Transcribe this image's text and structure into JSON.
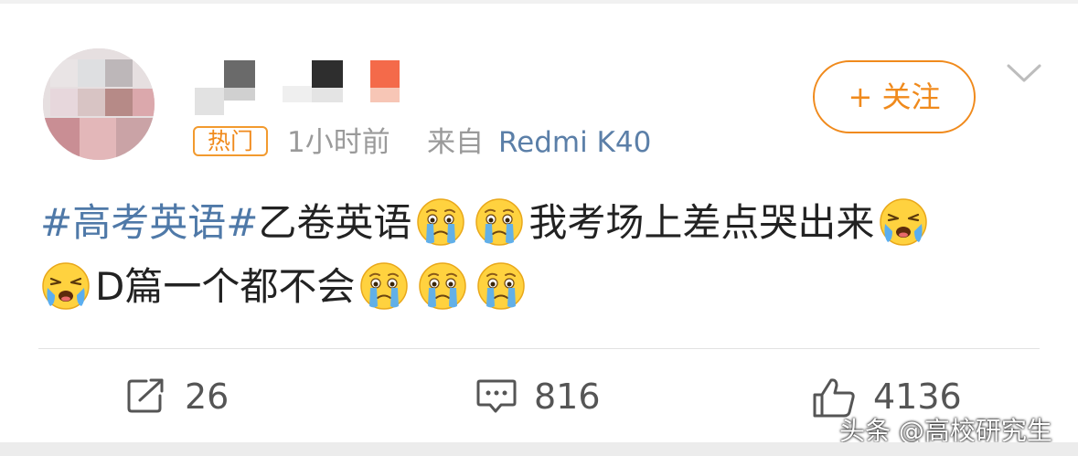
{
  "post": {
    "hot_badge": "热门",
    "time": "1小时前",
    "source_prefix": "来自",
    "source_device": "Redmi K40",
    "follow_label": "+ 关注",
    "text": {
      "topic": "#高考英语#",
      "line1_a": "乙卷英语",
      "line1_b": "我考场上差点哭出来",
      "line2": "D篇一个都不会"
    },
    "emoji_name": "crying-face-emoji"
  },
  "actions": {
    "repost_count": "26",
    "comment_count": "816",
    "like_count": "4136"
  },
  "watermark": "头条 @高校研究生",
  "colors": {
    "accent": "#f08a1c",
    "topic": "#4f79a8",
    "meta": "#9a9a9a",
    "device": "#5b7fa8"
  }
}
